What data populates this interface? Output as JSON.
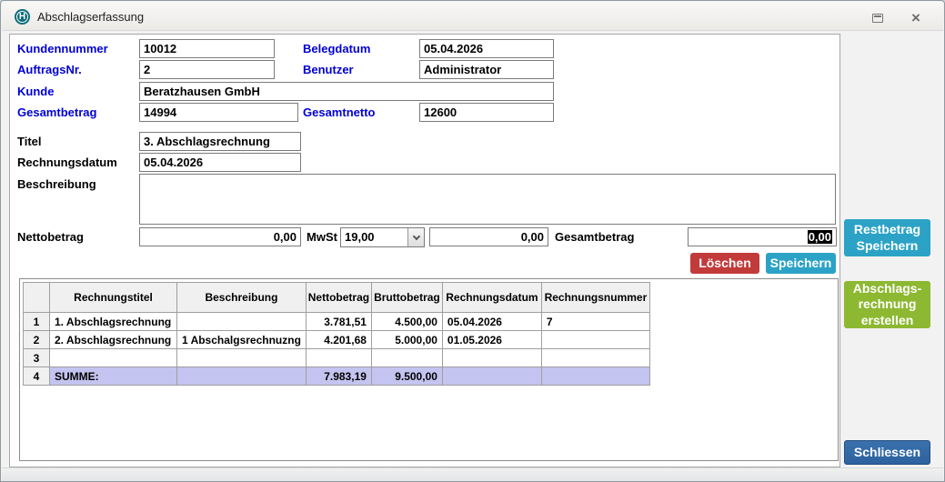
{
  "window": {
    "title": "Abschlagserfassung",
    "icon_letter": "H"
  },
  "form": {
    "kundennummer": {
      "label": "Kundennummer",
      "value": "10012"
    },
    "auftragsnr": {
      "label": "AuftragsNr.",
      "value": "2"
    },
    "kunde": {
      "label": "Kunde",
      "value": "Beratzhausen GmbH"
    },
    "gesamtbetrag": {
      "label": "Gesamtbetrag",
      "value": "14994"
    },
    "belegdatum": {
      "label": "Belegdatum",
      "value": "05.04.2026"
    },
    "benutzer": {
      "label": "Benutzer",
      "value": "Administrator"
    },
    "gesamtnetto": {
      "label": "Gesamtnetto",
      "value": "12600"
    },
    "titel": {
      "label": "Titel",
      "value": "3. Abschlagsrechnung"
    },
    "rechnungsdatum": {
      "label": "Rechnungsdatum",
      "value": "05.04.2026"
    },
    "beschreibung": {
      "label": "Beschreibung",
      "value": ""
    },
    "nettobetrag": {
      "label": "Nettobetrag",
      "value": "0,00"
    },
    "mwst": {
      "label": "MwSt",
      "selected": "19,00"
    },
    "mwst_betrag": {
      "value": "0,00"
    },
    "gesamtbetrag_summe": {
      "label": "Gesamtbetrag",
      "value": "0,00"
    }
  },
  "buttons": {
    "loeschen": "Löschen",
    "speichern": "Speichern",
    "restbetrag": {
      "line1": "Restbetrag",
      "line2": "Speichern"
    },
    "abschlag": {
      "line1": "Abschlags-",
      "line2": "rechnung",
      "line3": "erstellen"
    },
    "schliessen": "Schliessen"
  },
  "table": {
    "headers": [
      "",
      "Rechnungstitel",
      "Beschreibung",
      "Nettobetrag",
      "Bruttobetrag",
      "Rechnungsdatum",
      "Rechnungsnummer"
    ],
    "rows": [
      {
        "nr": "1",
        "titel": "1. Abschlagsrechnung",
        "beschreibung": "",
        "netto": "3.781,51",
        "brutto": "4.500,00",
        "datum": "05.04.2026",
        "nummer": "7"
      },
      {
        "nr": "2",
        "titel": "2. Abschlagsrechnung",
        "beschreibung": "1 Abschalgsrechnuzng",
        "netto": "4.201,68",
        "brutto": "5.000,00",
        "datum": "01.05.2026",
        "nummer": ""
      },
      {
        "nr": "3",
        "titel": "",
        "beschreibung": "",
        "netto": "",
        "brutto": "",
        "datum": "",
        "nummer": ""
      },
      {
        "nr": "4",
        "titel": "SUMME:",
        "beschreibung": "",
        "netto": "7.983,19",
        "brutto": "9.500,00",
        "datum": "",
        "nummer": ""
      }
    ]
  },
  "colors": {
    "label_blue": "#0000d4",
    "delete_red": "#c23b3b",
    "save_teal": "#2ca3c6",
    "create_green": "#8db831",
    "close_blue": "#2d629f",
    "summe_row": "#c4c4f0",
    "selection_bg": "#000000",
    "selection_text": "#ffffff",
    "title_icon_teal": "#0f6e79"
  }
}
